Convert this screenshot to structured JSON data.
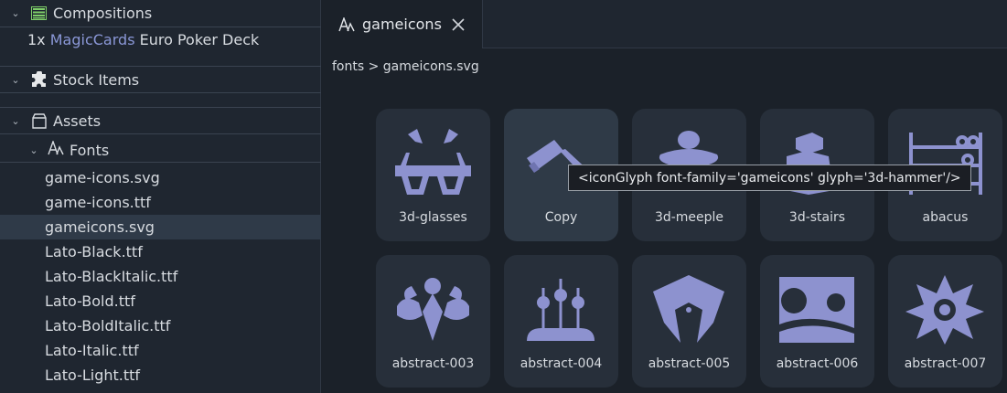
{
  "sidebar": {
    "compositions": {
      "label": "Compositions",
      "icon": "table-icon"
    },
    "composition_item": {
      "qty": "1x",
      "link": "MagicCards",
      "rest": "Euro Poker Deck"
    },
    "stock": {
      "label": "Stock Items",
      "icon": "puzzle-icon"
    },
    "assets": {
      "label": "Assets",
      "icon": "box-icon"
    },
    "fonts": {
      "label": "Fonts",
      "icon": "font-icon"
    },
    "files": [
      "game-icons.svg",
      "game-icons.ttf",
      "gameicons.svg",
      "Lato-Black.ttf",
      "Lato-BlackItalic.ttf",
      "Lato-Bold.ttf",
      "Lato-BoldItalic.ttf",
      "Lato-Italic.ttf",
      "Lato-Light.ttf"
    ],
    "selected_file": "gameicons.svg"
  },
  "tab": {
    "label": "gameicons",
    "icon": "font-icon",
    "close_icon": "close-icon"
  },
  "breadcrumb": "fonts > gameicons.svg",
  "glyphs": [
    {
      "label": "3d-glasses",
      "icon": "3d-glasses-icon"
    },
    {
      "label": "Copy",
      "icon": "3d-hammer-icon"
    },
    {
      "label": "3d-meeple",
      "icon": "3d-meeple-icon"
    },
    {
      "label": "3d-stairs",
      "icon": "3d-stairs-icon"
    },
    {
      "label": "abacus",
      "icon": "abacus-icon"
    },
    {
      "label": "abstract-003",
      "icon": "abstract-003-icon"
    },
    {
      "label": "abstract-004",
      "icon": "abstract-004-icon"
    },
    {
      "label": "abstract-005",
      "icon": "abstract-005-icon"
    },
    {
      "label": "abstract-006",
      "icon": "abstract-006-icon"
    },
    {
      "label": "abstract-007",
      "icon": "abstract-007-icon"
    }
  ],
  "tooltip": "<iconGlyph font-family='gameicons' glyph='3d-hammer'/>",
  "colors": {
    "glyph": "#8d92cf",
    "link": "#8a97d6",
    "compositions_icon": "#7fcf6a"
  }
}
